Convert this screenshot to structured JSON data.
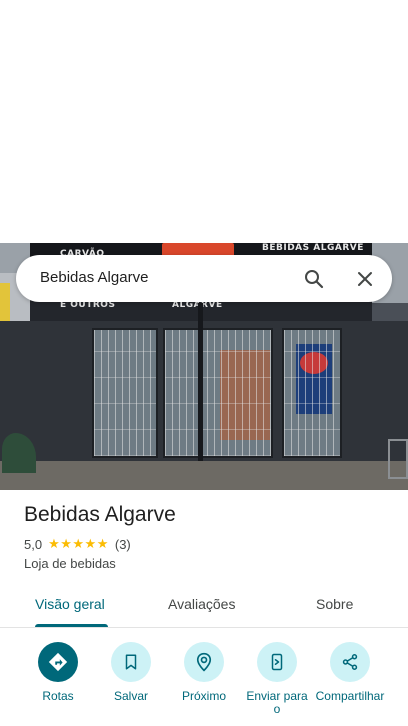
{
  "search": {
    "query": "Bebidas Algarve"
  },
  "photo": {
    "sign_top_left": "CARVÃO",
    "sign_top_right": "BEBIDAS ALGARVE",
    "sign_bottom_left": "E OUTROS",
    "sign_bottom_center": "ALGARVE"
  },
  "place": {
    "name": "Bebidas Algarve",
    "rating": "5,0",
    "stars": "★★★★★",
    "review_count": "(3)",
    "category": "Loja de bebidas"
  },
  "tabs": [
    {
      "label": "Visão geral",
      "active": true
    },
    {
      "label": "Avaliações",
      "active": false
    },
    {
      "label": "Sobre",
      "active": false
    }
  ],
  "actions": [
    {
      "label": "Rotas",
      "icon": "directions-icon"
    },
    {
      "label": "Salvar",
      "icon": "bookmark-icon"
    },
    {
      "label": "Próximo",
      "icon": "nearby-icon"
    },
    {
      "label": "Enviar para o",
      "icon": "send-to-phone-icon"
    },
    {
      "label": "Compartilhar",
      "icon": "share-icon"
    }
  ],
  "colors": {
    "accent": "#00687a",
    "accent_light": "#cdf2f6",
    "star": "#fbbc04"
  }
}
